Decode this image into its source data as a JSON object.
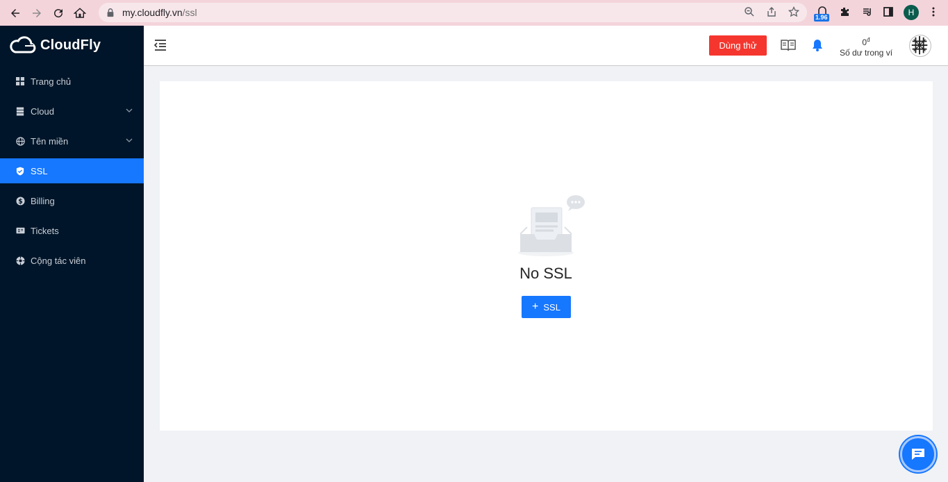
{
  "browser": {
    "url_host": "my.cloudfly.vn",
    "url_path": "/ssl",
    "extension_badge": "1.96",
    "profile_initial": "H"
  },
  "brand": {
    "name": "CloudFly"
  },
  "sidebar": {
    "items": [
      {
        "label": "Trang chủ",
        "icon": "grid-icon"
      },
      {
        "label": "Cloud",
        "icon": "server-icon"
      },
      {
        "label": "Tên miền",
        "icon": "globe-icon"
      },
      {
        "label": "SSL",
        "icon": "shield-icon"
      },
      {
        "label": "Billing",
        "icon": "dollar-icon"
      },
      {
        "label": "Tickets",
        "icon": "ticket-icon"
      },
      {
        "label": "Cộng tác viên",
        "icon": "affiliate-icon"
      }
    ],
    "active": "SSL"
  },
  "header": {
    "trial_label": "Dùng thử",
    "balance_amount": "0",
    "currency": "đ",
    "balance_label": "Số dư trong ví"
  },
  "main": {
    "empty_title": "No SSL",
    "add_button_label": "SSL"
  },
  "colors": {
    "sidebar_bg": "#001529",
    "accent": "#1677ff",
    "trial_red": "#f5362e",
    "browser_bar": "#f4d4db"
  }
}
